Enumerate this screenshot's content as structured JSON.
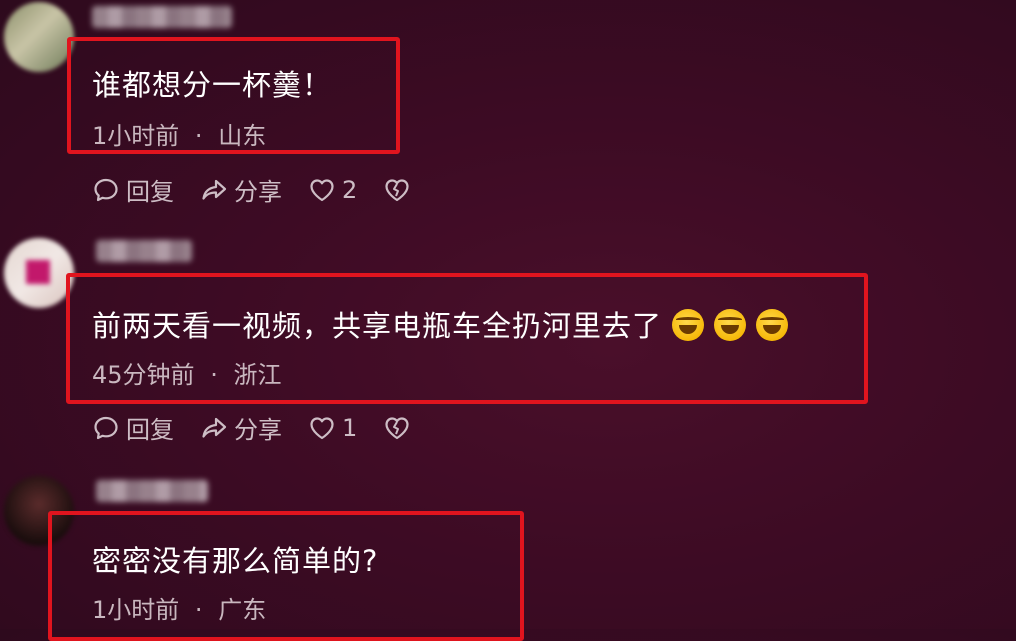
{
  "comments": [
    {
      "text": "谁都想分一杯羹！",
      "time": "1小时前",
      "location": "山东",
      "reply_label": "回复",
      "share_label": "分享",
      "likes": "2",
      "emojis": []
    },
    {
      "text": "前两天看一视频，共享电瓶车全扔河里去了",
      "time": "45分钟前",
      "location": "浙江",
      "reply_label": "回复",
      "share_label": "分享",
      "likes": "1",
      "emojis": [
        "laughing-tears",
        "laughing-tears",
        "laughing-tears"
      ]
    },
    {
      "text": "密密没有那么简单的?",
      "time": "1小时前",
      "location": "广东"
    }
  ],
  "meta_separator": "·",
  "colors": {
    "background": "#3d0b24",
    "highlight_box": "#e0141e",
    "meta_text": "#c9b7bf"
  },
  "icons": {
    "reply": "speech-bubble-icon",
    "share": "share-arrow-icon",
    "like": "heart-outline-icon",
    "dislike": "broken-heart-icon"
  }
}
